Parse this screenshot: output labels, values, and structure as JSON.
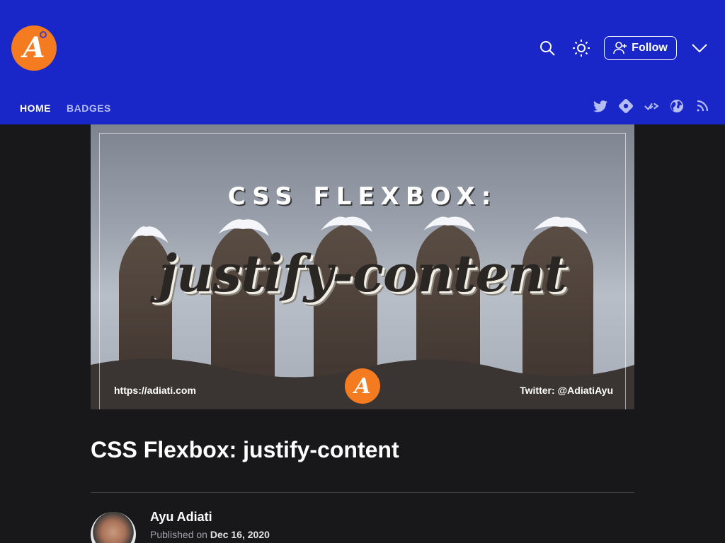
{
  "header": {
    "logo_letter": "A",
    "follow_label": "Follow",
    "icons": [
      "search-icon",
      "sun-icon",
      "chevron-down-icon"
    ]
  },
  "nav": {
    "items": [
      {
        "label": "HOME",
        "active": true
      },
      {
        "label": "BADGES",
        "active": false
      }
    ]
  },
  "social": {
    "icons": [
      "twitter-icon",
      "hashnode-icon",
      "devto-icon",
      "globe-icon",
      "rss-icon"
    ]
  },
  "cover": {
    "heading": "CSS FLEXBOX:",
    "script": "justify-content",
    "url": "https://adiati.com",
    "twitter": "Twitter: @AdiatiAyu",
    "logo_letter": "A"
  },
  "article": {
    "title": "CSS Flexbox: justify-content",
    "author": "Ayu Adiati",
    "published_prefix": "Published on",
    "published_date": "Dec 16, 2020"
  },
  "colors": {
    "header_bg": "#1927c8",
    "page_bg": "#18181b",
    "logo_orange": "#f47b20"
  }
}
